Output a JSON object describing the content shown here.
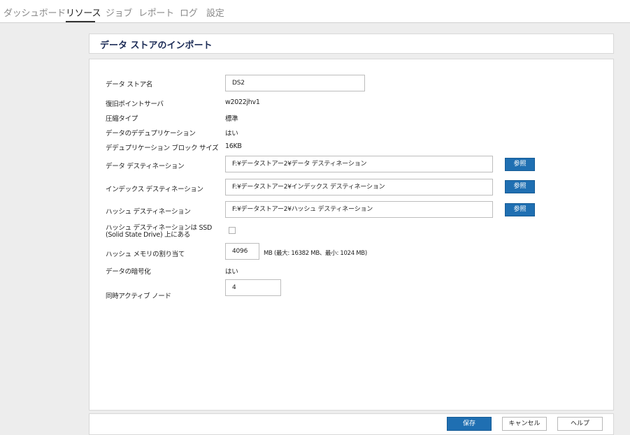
{
  "nav": {
    "tabs": [
      "ダッシュボード",
      "リソース",
      "ジョブ",
      "レポート",
      "ログ",
      "設定"
    ],
    "active_tab": "リソース"
  },
  "page": {
    "title": "データ ストアのインポート"
  },
  "form": {
    "datastore_name": {
      "label": "データ ストア名",
      "value": "DS2"
    },
    "recovery_point_server": {
      "label": "復旧ポイントサーバ",
      "value": "w2022jhv1"
    },
    "compression_type": {
      "label": "圧縮タイプ",
      "value": "標準"
    },
    "deduplication": {
      "label": "データのデデュプリケーション",
      "value": "はい"
    },
    "dedup_block_size": {
      "label": "デデュプリケーション ブロック サイズ",
      "value": "16KB"
    },
    "data_destination": {
      "label": "データ デスティネーション",
      "value": "F:¥データストアー2¥データ デスティネーション"
    },
    "index_destination": {
      "label": "インデックス デスティネーション",
      "value": "F:¥データストアー2¥インデックス デスティネーション"
    },
    "hash_destination": {
      "label": "ハッシュ デスティネーション",
      "value": "F:¥データストアー2¥ハッシュ デスティネーション"
    },
    "hash_on_ssd": {
      "label": "ハッシュ デスティネーションは SSD (Solid State Drive) 上にある",
      "checked": false
    },
    "hash_memory": {
      "label": "ハッシュ メモリの割り当て",
      "value": "4096",
      "unit_text": "MB (最大: 16382 MB、最小: 1024 MB)"
    },
    "encryption": {
      "label": "データの暗号化",
      "value": "はい"
    },
    "concurrent_nodes": {
      "label": "同時アクティブ ノード",
      "value": "4"
    },
    "browse_label": "参照"
  },
  "footer": {
    "save": "保存",
    "cancel": "キャンセル",
    "help": "ヘルプ"
  },
  "colors": {
    "primary_button": "#1f6fb2",
    "title_text": "#1a2a55",
    "background": "#ededed"
  }
}
